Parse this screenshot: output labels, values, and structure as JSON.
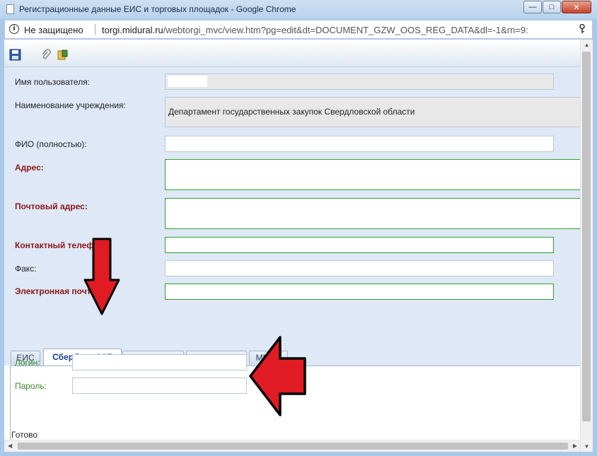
{
  "window": {
    "title": "Регистрационные данные ЕИС и торговых площадок - Google Chrome",
    "minimize_icon": "minimize-icon",
    "maximize_icon": "maximize-icon",
    "close_icon": "close-icon"
  },
  "address_bar": {
    "security_label": "Не защищено",
    "url_host": "torgi.midural.ru",
    "url_path": "/webtorgi_mvc/view.htm?pg=edit&dt=DOCUMENT_GZW_OOS_REG_DATA&dl=-1&rn=9:"
  },
  "toolbar": {
    "buttons": [
      "save-icon",
      "attach-icon",
      "export-icon"
    ]
  },
  "form": {
    "fields": [
      {
        "label": "Имя пользователя:",
        "value": "",
        "required": false,
        "readonly": true
      },
      {
        "label": "Наименование учреждения:",
        "value": "Департамент государственных закупок Свердловской области",
        "required": false,
        "readonly": true
      },
      {
        "label": "ФИО (полностью):",
        "value": "",
        "required": false,
        "readonly": false
      },
      {
        "label": "Адрес:",
        "value": "",
        "required": true,
        "readonly": false
      },
      {
        "label": "Почтовый адрес:",
        "value": "",
        "required": true,
        "readonly": false
      },
      {
        "label": "Контактный телефон:",
        "value": "",
        "required": true,
        "readonly": false
      },
      {
        "label": "Факс:",
        "value": "",
        "required": false,
        "readonly": false
      },
      {
        "label": "Электронная почта:",
        "value": "",
        "required": true,
        "readonly": false
      }
    ]
  },
  "tabs": [
    {
      "label": "ЕИС",
      "active": false
    },
    {
      "label": "Сбербанк АСТ",
      "active": true
    },
    {
      "label": "РТС-Тендер",
      "active": false
    },
    {
      "label": "Единая ЭТП",
      "active": false
    },
    {
      "label": "ММВБ",
      "active": false
    }
  ],
  "tab_panel": {
    "login_label": "Логин:",
    "login_value": "",
    "password_label": "Пароль:",
    "password_value": ""
  },
  "status": "Готово",
  "colors": {
    "required_label": "#8b1616",
    "green_border": "#31a031",
    "form_bg": "#dfe8f6",
    "annotation_arrow": "#e01b24"
  }
}
